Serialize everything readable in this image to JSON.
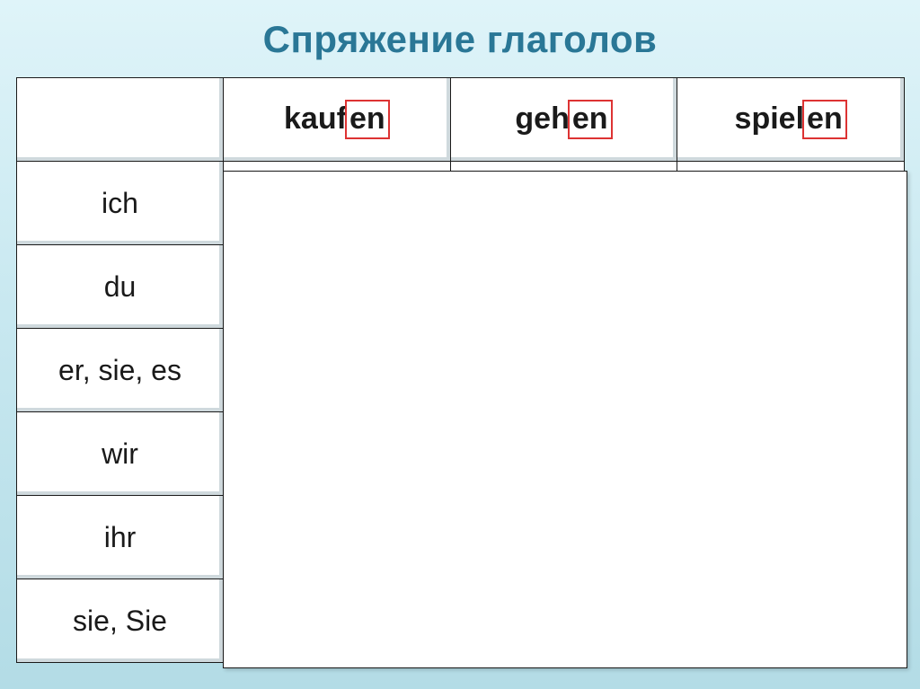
{
  "title": "Спряжение глаголов",
  "verbs": [
    {
      "stem": "kauf",
      "ending": "en"
    },
    {
      "stem": "geh",
      "ending": "en"
    },
    {
      "stem": "spiel",
      "ending": "en"
    }
  ],
  "pronouns": [
    "ich",
    "du",
    "er, sie, es",
    "wir",
    "ihr",
    "sie, Sie"
  ]
}
